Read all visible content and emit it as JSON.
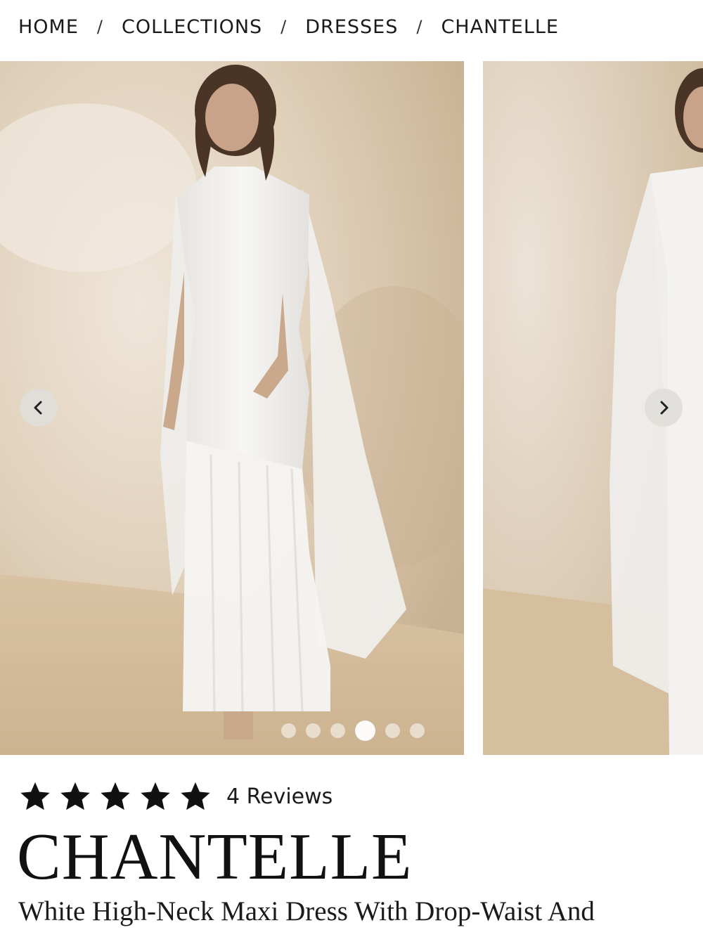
{
  "breadcrumb": {
    "items": [
      "HOME",
      "COLLECTIONS",
      "DRESSES",
      "CHANTELLE"
    ],
    "separator": "/"
  },
  "gallery": {
    "total_images": 6,
    "active_index": 3,
    "prev_icon": "chevron-left-icon",
    "next_icon": "chevron-right-icon"
  },
  "product": {
    "rating": 5,
    "reviews_label": "4 Reviews",
    "name": "CHANTELLE",
    "subtitle": "White High-Neck Maxi Dress With Drop-Waist And"
  },
  "colors": {
    "backdrop": "#d9c8b2",
    "dress": "#f4f3f1",
    "text": "#111111"
  }
}
